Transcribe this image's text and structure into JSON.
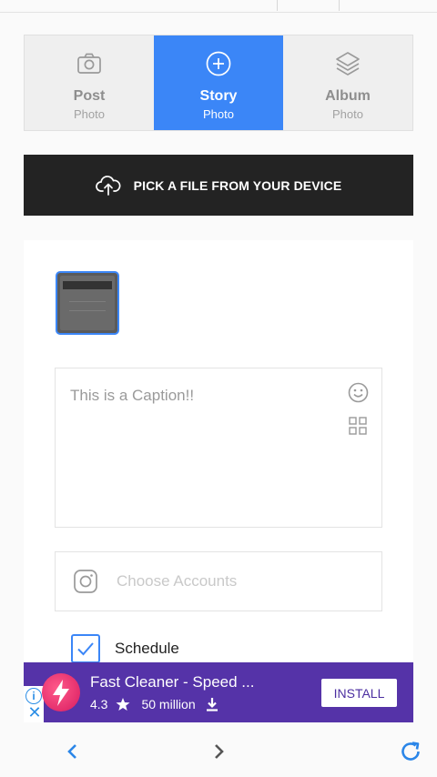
{
  "tabs": [
    {
      "title": "Post",
      "subtitle": "Photo",
      "icon": "camera-icon",
      "active": false
    },
    {
      "title": "Story",
      "subtitle": "Photo",
      "icon": "plus-circle-icon",
      "active": true
    },
    {
      "title": "Album",
      "subtitle": "Photo",
      "icon": "layers-icon",
      "active": false
    }
  ],
  "pick_button": {
    "label": "PICK A FILE FROM YOUR DEVICE",
    "icon": "cloud-upload-icon"
  },
  "caption": {
    "placeholder": "This is a Caption!!"
  },
  "accounts": {
    "placeholder": "Choose Accounts",
    "icon": "instagram-icon"
  },
  "schedule": {
    "label": "Schedule",
    "checked": true
  },
  "ad": {
    "title": "Fast Cleaner - Speed ...",
    "rating": "4.3",
    "downloads": "50 million",
    "install_label": "INSTALL",
    "info_glyph": "i",
    "close_glyph": "✕"
  },
  "colors": {
    "accent": "#3b86f7",
    "pick_bg": "#232323",
    "ad_bg": "#5533a8"
  }
}
